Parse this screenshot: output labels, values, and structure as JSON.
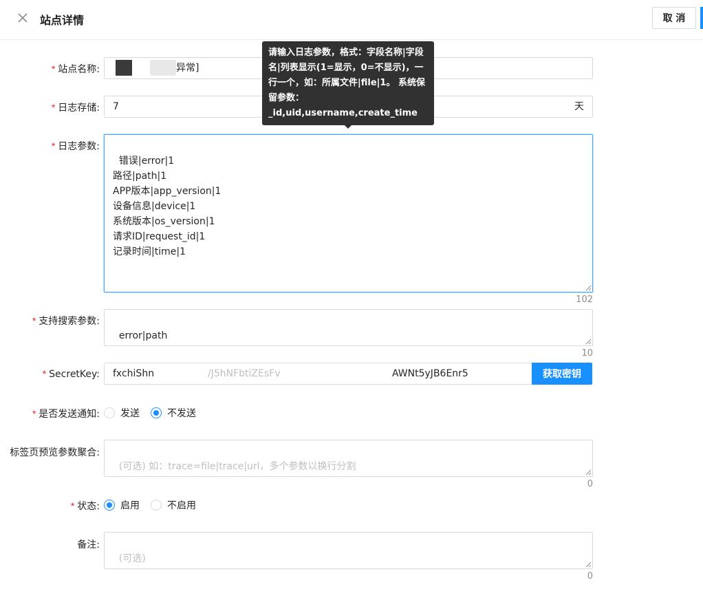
{
  "header": {
    "title": "站点详情",
    "cancel_label": "取 消"
  },
  "form": {
    "site_name": {
      "label": "站点名称:",
      "value_suffix": "异常]"
    },
    "log_storage": {
      "label": "日志存储:",
      "value": "7",
      "suffix": "天"
    },
    "log_params": {
      "label": "日志参数:",
      "value": "错误|error|1\n路径|path|1\nAPP版本|app_version|1\n设备信息|device|1\n系统版本|os_version|1\n请求ID|request_id|1\n记录时间|time|1",
      "count": "102"
    },
    "search_params": {
      "label": "支持搜索参数:",
      "value": "error|path",
      "count": "10"
    },
    "secret_key": {
      "label": "SecretKey:",
      "value_start": "fxchiShn",
      "value_mid": "/J5hNFbtiZEsFv",
      "value_end": "AWNt5yJB6Enr5",
      "button_label": "获取密钥"
    },
    "notify": {
      "label": "是否发送通知:",
      "options": [
        "发送",
        "不发送"
      ],
      "selected": "不发送"
    },
    "tab_preview": {
      "label": "标签页预览参数聚合:",
      "placeholder": "(可选) 如：trace=file|trace|url，多个参数以换行分割",
      "count": "0"
    },
    "status": {
      "label": "状态:",
      "options": [
        "启用",
        "不启用"
      ],
      "selected": "启用"
    },
    "remark": {
      "label": "备注:",
      "placeholder": "(可选)",
      "count": "0"
    }
  },
  "tooltip": {
    "text": "请输入日志参数，格式：字段名称|字段名|列表显示(1=显示，0=不显示)，一行一个，如：所属文件|file|1。 系统保留参数：_id,uid,username,create_time"
  },
  "colors": {
    "primary": "#1890ff",
    "required": "#f5222d",
    "border": "#d9d9d9"
  }
}
